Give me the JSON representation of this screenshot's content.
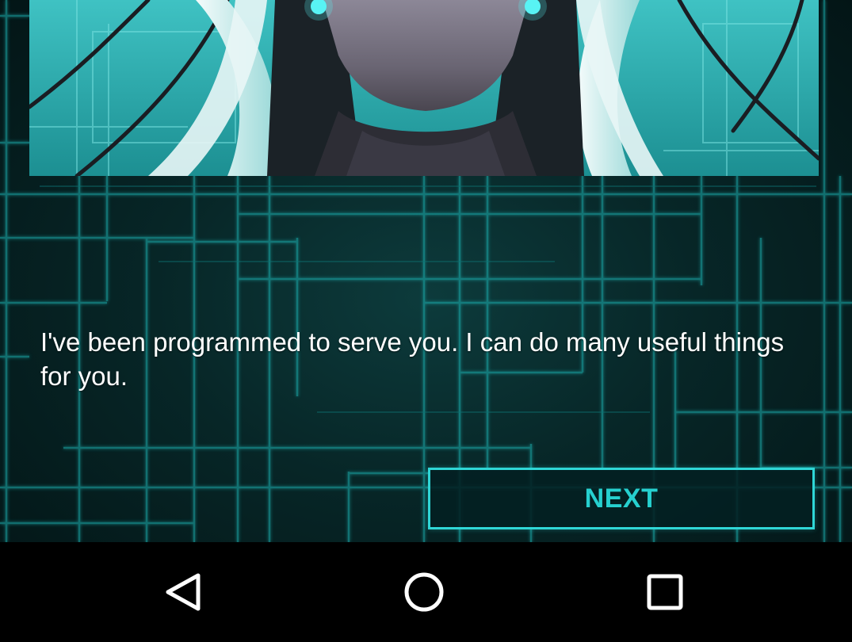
{
  "dialog": {
    "message": "I've been programmed to serve you. I can do many useful things for you."
  },
  "actions": {
    "next_label": "NEXT"
  },
  "navbar": {
    "back_icon": "back-triangle-icon",
    "home_icon": "home-circle-icon",
    "recents_icon": "recents-square-icon"
  },
  "colors": {
    "accent": "#26d0cf",
    "background": "#072627",
    "navbar": "#000000"
  }
}
